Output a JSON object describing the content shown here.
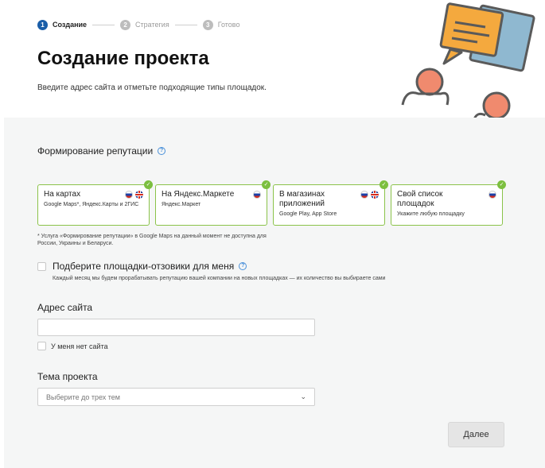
{
  "stepper": {
    "steps": [
      {
        "num": "1",
        "label": "Создание"
      },
      {
        "num": "2",
        "label": "Стратегия"
      },
      {
        "num": "3",
        "label": "Готово"
      }
    ]
  },
  "header": {
    "title": "Создание проекта",
    "subtitle": "Введите адрес сайта и отметьте подходящие типы площадок."
  },
  "reputation": {
    "title": "Формирование репутации",
    "help": "?",
    "cards": [
      {
        "title": "На картах",
        "desc": "Google Maps*, Яндекс.Карты и 2ГИС",
        "check": "✓",
        "flags": [
          "ru",
          "uk"
        ]
      },
      {
        "title": "На Яндекс.Маркете",
        "desc": "Яндекс.Маркет",
        "check": "✓",
        "flags": [
          "ru"
        ]
      },
      {
        "title": "В магазинах приложений",
        "desc": "Google Play, App Store",
        "check": "✓",
        "flags": [
          "ru",
          "uk"
        ]
      },
      {
        "title": "Свой список площадок",
        "desc": "Укажите любую площадку",
        "check": "✓",
        "flags": [
          "ru"
        ]
      }
    ],
    "footnote": "* Услуга «Формирование репутации» в Google Maps на данный момент не доступна для России, Украины и Беларуси."
  },
  "auto_select": {
    "label": "Подберите площадки-отзовики для меня",
    "help": "?",
    "description": "Каждый месяц мы будем прорабатывать репутацию вашей компании на новых площадках — их количество вы выбираете сами",
    "checked": false
  },
  "site": {
    "label": "Адрес сайта",
    "value": "",
    "no_site_label": "У меня нет сайта",
    "no_site_checked": false
  },
  "topic": {
    "label": "Тема проекта",
    "placeholder": "Выберите до трех тем",
    "chevron": "⌄"
  },
  "actions": {
    "next_label": "Далее"
  },
  "colors": {
    "accent": "#1a5ea8",
    "card_border": "#8bc34a",
    "check": "#7cbf3f",
    "help": "#4a90d9"
  },
  "icons": {
    "illustration": "reviews-chat-people-illustration",
    "check": "check-icon",
    "help": "question-icon",
    "chevron": "chevron-down-icon"
  }
}
